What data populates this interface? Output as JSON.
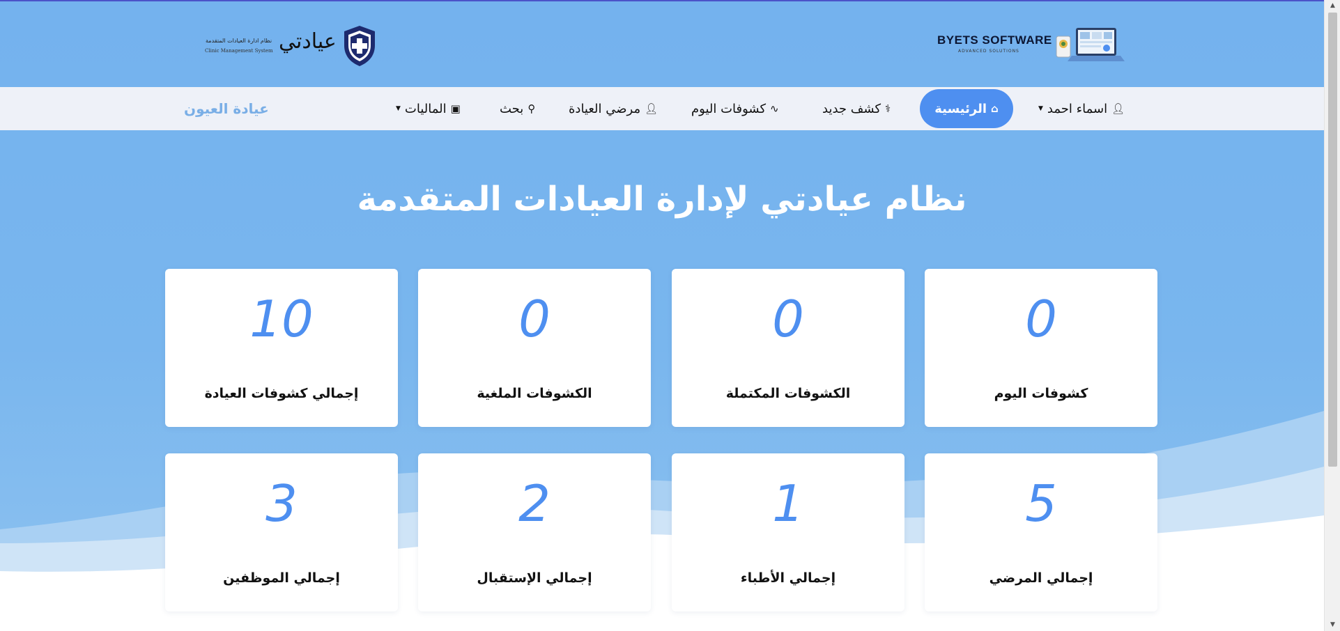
{
  "header": {
    "brand": {
      "name": "عيادتي",
      "tagline_ar": "نظام ادارة العيادات المتقدمة",
      "tagline_en": "Clinic Management System"
    },
    "vendor": {
      "name": "BYETS SOFTWARE",
      "tagline": "ADVANCED SOLUTIONS"
    }
  },
  "nav": {
    "user": "اسماء احمد",
    "items": [
      {
        "label": "الرئيسية",
        "icon": "home-icon",
        "active": true
      },
      {
        "label": "كشف جديد",
        "icon": "user-doctor-icon"
      },
      {
        "label": "كشوفات اليوم",
        "icon": "stethoscope-icon"
      },
      {
        "label": "مرضي العيادة",
        "icon": "user-icon"
      },
      {
        "label": "بحث",
        "icon": "search-icon"
      },
      {
        "label": "الماليات",
        "icon": "money-bill-icon"
      }
    ],
    "clinic": "عيادة العيون"
  },
  "hero": {
    "title": "نظام عيادتي لإدارة العيادات المتقدمة"
  },
  "stats": [
    {
      "value": "0",
      "label": "كشوفات اليوم"
    },
    {
      "value": "0",
      "label": "الكشوفات المكتملة"
    },
    {
      "value": "0",
      "label": "الكشوفات الملغية"
    },
    {
      "value": "10",
      "label": "إجمالي كشوفات العيادة"
    },
    {
      "value": "5",
      "label": "إجمالي المرضي"
    },
    {
      "value": "1",
      "label": "إجمالي الأطباء"
    },
    {
      "value": "2",
      "label": "إجمالي الإستقبال"
    },
    {
      "value": "3",
      "label": "إجمالي الموظفين"
    }
  ],
  "colors": {
    "accent": "#4e8ff0",
    "background": "#78b4ee",
    "nav_bg": "#eef1f8",
    "clinic_name": "#79aee6"
  }
}
